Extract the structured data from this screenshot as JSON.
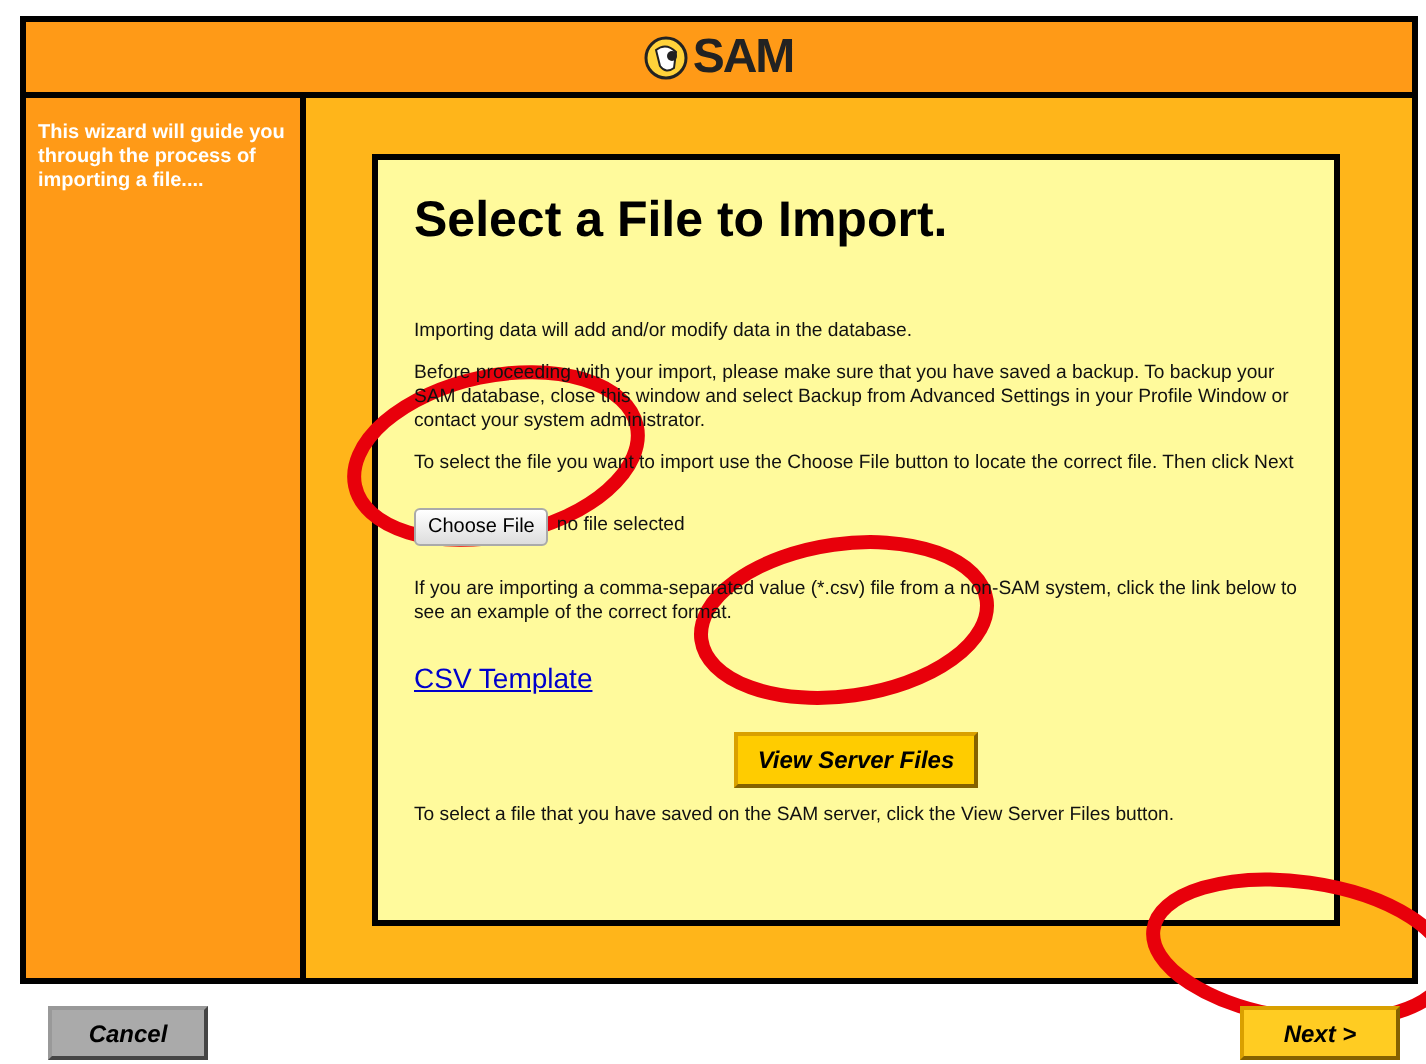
{
  "header": {
    "logo_text": "SAM"
  },
  "sidebar": {
    "text": "This wizard will guide you through the process of importing a file...."
  },
  "panel": {
    "title": "Select a File to Import.",
    "paragraphs": [
      "Importing data will add and/or modify data in the database.",
      "Before proceeding with your import, please make sure that you have saved a backup. To backup your SAM database, close this window and select Backup from Advanced Settings in your Profile Window or contact your system administrator.",
      "To select the file you want to import use the Choose File button to locate the correct file. Then click Next"
    ],
    "file_input": {
      "button": "Choose File",
      "status": "no file selected"
    },
    "csv_note": "If you are importing a comma-separated value (*.csv) file from a non-SAM system, click the link below to see an example of the correct format.",
    "link": "CSV Template",
    "server_button": "View Server Files",
    "server_note": "To select a file that you have saved on the SAM server, click the View Server Files button."
  },
  "footer": {
    "buttons": [
      {
        "label": "Cancel",
        "kind": "secondary"
      },
      {
        "label": "Next >",
        "kind": "primary"
      }
    ]
  },
  "annotations": [
    {
      "kind": "ellipse"
    },
    {
      "kind": "ellipse"
    },
    {
      "kind": "ellipse"
    }
  ]
}
